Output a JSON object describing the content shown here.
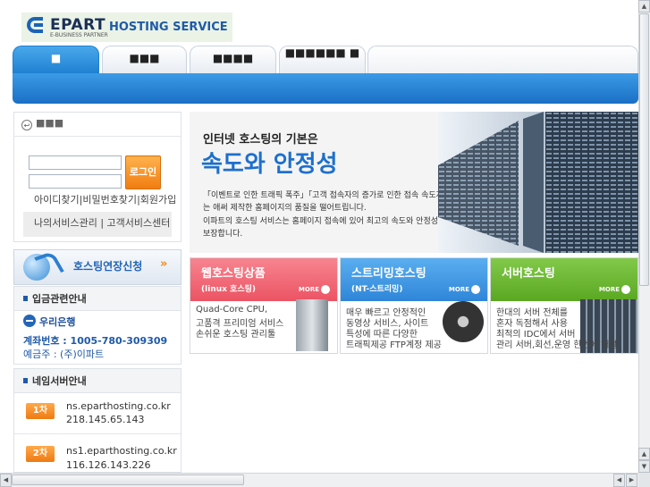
{
  "logo": {
    "brand": "EPART",
    "sub": "E-BUSINESS PARTNER",
    "service": "HOSTING SERVICE"
  },
  "tabs": [
    "■",
    "■■■",
    "■■■■",
    "■■■■■■ ■"
  ],
  "login": {
    "title": "■■■",
    "button": "로그인",
    "links": [
      "아이디찾기",
      "비밀번호찾기",
      "회원가입"
    ],
    "my_service": "나의서비스관리 | 고객서비스센터"
  },
  "extend_banner": {
    "label": "호스팅연장신청",
    "arrow": "»"
  },
  "deposit": {
    "heading": "입금관련안내",
    "bank": "우리은행",
    "account": "계좌번호 : 1005-780-309309",
    "holder": "예금주 : (주)이파트"
  },
  "nameserver": {
    "heading": "네임서버안내",
    "items": [
      {
        "badge": "1차",
        "host": "ns.eparthosting.co.kr",
        "ip": "218.145.65.143"
      },
      {
        "badge": "2차",
        "host": "ns1.eparthosting.co.kr",
        "ip": "116.126.143.226"
      }
    ]
  },
  "hero": {
    "subtitle": "인터넷 호스팅의 기본은",
    "title": "속도와 안정성",
    "lines": [
      "「이벤트로 인한 트래픽 폭주」「고객 접속자의 증가로 인한 접속 속도저하」",
      "는 애써 제작한 홈페이지의 품질을 떨어트립니다.",
      "이파트의 호스팅 서비스는 홈페이지 접속에 있어 최고의 속도와 안정성을",
      "보장합니다."
    ]
  },
  "cards": [
    {
      "title": "웹호스팅상품",
      "tag": "(linux 호스팅)",
      "more": "MORE",
      "color": "#f0606e",
      "lines": [
        "Quad-Core CPU,",
        "고품격 프리미엄 서비스",
        "손쉬운 호스팅 관리툴"
      ]
    },
    {
      "title": "스트리밍호스팅",
      "tag": "(NT-스트리밍)",
      "more": "MORE",
      "color": "#3d97e4",
      "lines": [
        "매우 빠르고 안정적인",
        "동영상 서비스, 사이트",
        "특성에 따른 다양한",
        "트래픽제공 FTP계정 제공"
      ]
    },
    {
      "title": "서버호스팅",
      "tag": "",
      "more": "MORE",
      "color": "#66b62c",
      "lines": [
        "한대의 서버 전체를",
        "혼자 독점해서 사용",
        "최적의 IDC에서 서버",
        "관리 서버,회선,운영 한번에 해결"
      ]
    }
  ],
  "scroll": {
    "up": "▲",
    "down": "▼",
    "left": "◀",
    "right": "▶"
  }
}
